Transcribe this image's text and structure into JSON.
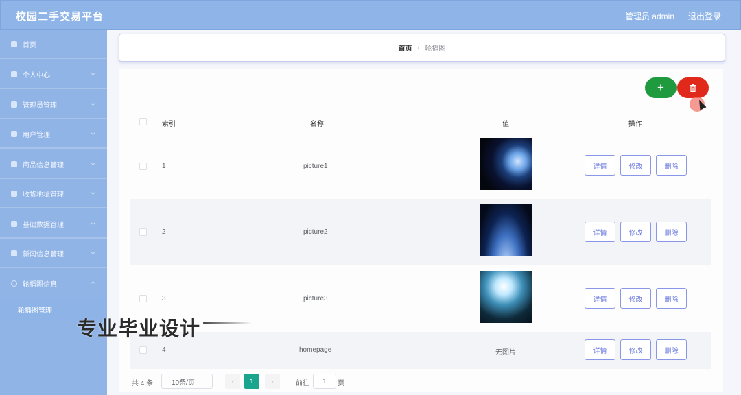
{
  "header": {
    "title": "校园二手交易平台",
    "admin_label": "管理员 admin",
    "logout_label": "退出登录"
  },
  "sidebar": {
    "items": [
      {
        "label": "首页",
        "icon": "home-icon"
      },
      {
        "label": "个人中心",
        "icon": "user-icon"
      },
      {
        "label": "管理员管理",
        "icon": "admin-icon"
      },
      {
        "label": "用户管理",
        "icon": "users-icon"
      },
      {
        "label": "商品信息管理",
        "icon": "goods-icon"
      },
      {
        "label": "收货地址管理",
        "icon": "address-icon"
      },
      {
        "label": "基础数据管理",
        "icon": "data-icon"
      },
      {
        "label": "新闻信息管理",
        "icon": "news-icon"
      },
      {
        "label": "轮播图信息",
        "icon": "carousel-icon"
      }
    ],
    "submenu_label": "轮播图管理"
  },
  "breadcrumb": {
    "home": "首页",
    "separator": "/",
    "current": "轮播图"
  },
  "toolbar": {
    "add_label": "+",
    "delete_icon": "trash-icon",
    "add_color": "#1f9a3f",
    "delete_color": "#e0291b"
  },
  "table": {
    "headers": {
      "index": "索引",
      "name": "名称",
      "value": "值",
      "actions": "操作"
    },
    "rows": [
      {
        "index": "1",
        "name": "picture1",
        "value": "",
        "image": "space-planet-image"
      },
      {
        "index": "2",
        "name": "picture2",
        "value": "",
        "image": "earth-horizon-image"
      },
      {
        "index": "3",
        "name": "picture3",
        "value": "",
        "image": "crystal-light-image"
      },
      {
        "index": "4",
        "name": "homepage",
        "value": "无图片",
        "image": ""
      }
    ],
    "actions": {
      "detail": "详情",
      "edit": "修改",
      "delete": "删除"
    }
  },
  "pagination": {
    "total": "共 4 条",
    "page_size": "10条/页",
    "prev": "‹",
    "current": "1",
    "next": "›",
    "goto_label": "前往",
    "goto_value": "1",
    "unit": "页"
  },
  "watermark": "专业毕业设计",
  "colors": {
    "topbar": "#8eb4e8",
    "sidebar": "#90b4e6",
    "accent_page": "#1aa58e",
    "action_border": "#8a96e8"
  }
}
